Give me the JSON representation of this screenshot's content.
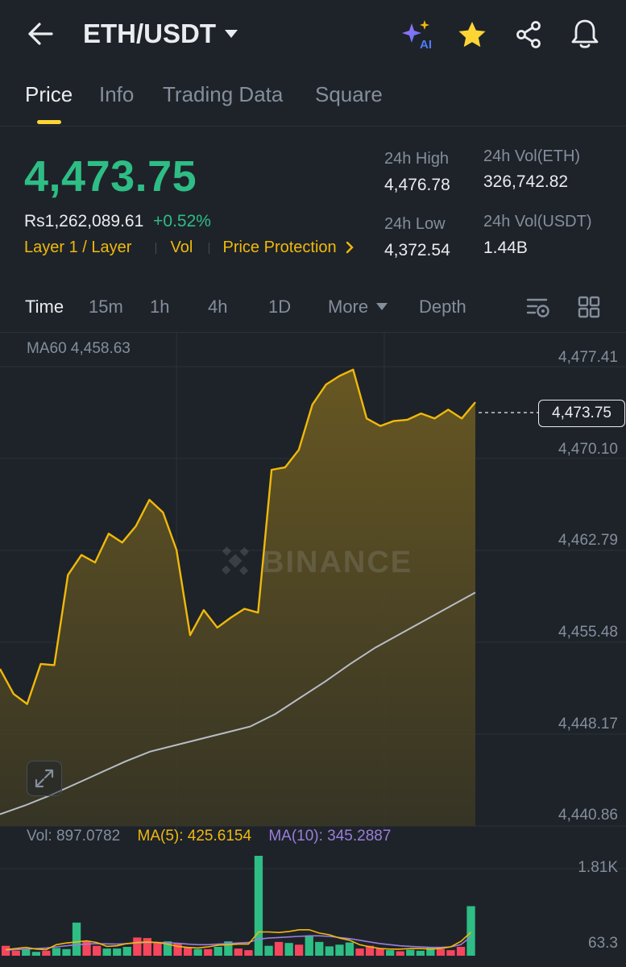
{
  "header": {
    "pair": "ETH/USDT",
    "icons": [
      "back-arrow-icon",
      "ai-sparkle-icon",
      "star-icon",
      "share-icon",
      "bell-icon"
    ],
    "ai_label": "AI"
  },
  "tabs": [
    {
      "label": "Price",
      "active": true
    },
    {
      "label": "Info"
    },
    {
      "label": "Trading Data"
    },
    {
      "label": "Square"
    }
  ],
  "ticker": {
    "last_price": "4,473.75",
    "fiat_price": "Rs1,262,089.61",
    "change_pct": "+0.52%",
    "tag_category": "Layer 1 / Layer",
    "tag_vol": "Vol",
    "price_protection": "Price Protection",
    "high_label": "24h High",
    "high_value": "4,476.78",
    "low_label": "24h Low",
    "low_value": "4,372.54",
    "vol_eth_label": "24h Vol(ETH)",
    "vol_eth_value": "326,742.82",
    "vol_usdt_label": "24h Vol(USDT)",
    "vol_usdt_value": "1.44B"
  },
  "timeframes": {
    "items": [
      "Time",
      "15m",
      "1h",
      "4h",
      "1D"
    ],
    "active": "Time",
    "more_label": "More",
    "depth_label": "Depth"
  },
  "chart": {
    "ma60_label": "MA60 4,458.63",
    "watermark": "BINANCE",
    "current_price": "4,473.75",
    "y_axis": [
      "4,477.41",
      "4,470.10",
      "4,462.79",
      "4,455.48",
      "4,448.17",
      "4,440.86"
    ],
    "vol_label": "Vol: 897.0782",
    "ma5_label": "MA(5): 425.6154",
    "ma10_label": "MA(10): 345.2887",
    "vol_axis": [
      "1.81K",
      "63.3"
    ]
  },
  "colors": {
    "up": "#2ebd85",
    "down": "#f6465d",
    "accent": "#fcd535",
    "price_line": "#f0b90b",
    "ma_line": "#b7bdc6",
    "ma10": "#9c7ddb"
  },
  "chart_data": {
    "type": "area",
    "title": "",
    "ylim": [
      4440.86,
      4477.41
    ],
    "price": [
      4452.5,
      4450.5,
      4449.7,
      4452.9,
      4452.8,
      4460.0,
      4461.6,
      4461.0,
      4463.3,
      4462.6,
      4463.9,
      4466.0,
      4465.0,
      4462.0,
      4455.2,
      4457.2,
      4455.8,
      4456.6,
      4457.3,
      4457.0,
      4468.4,
      4468.6,
      4470.0,
      4473.6,
      4475.2,
      4475.9,
      4476.4,
      4472.5,
      4471.9,
      4472.3,
      4472.4,
      4472.9,
      4472.5,
      4473.2,
      4472.5,
      4473.8
    ],
    "ma60": [
      4440.9,
      4441.6,
      4442.4,
      4443.3,
      4444.2,
      4445.1,
      4445.9,
      4446.4,
      4446.9,
      4447.4,
      4447.9,
      4448.9,
      4450.2,
      4451.5,
      4452.9,
      4454.2,
      4455.3,
      4456.4,
      4457.5,
      4458.6
    ],
    "volume": [
      180,
      90,
      110,
      70,
      90,
      140,
      120,
      600,
      270,
      180,
      130,
      130,
      160,
      330,
      320,
      230,
      260,
      220,
      150,
      120,
      120,
      160,
      260,
      130,
      100,
      1810,
      180,
      250,
      230,
      200,
      350,
      250,
      170,
      200,
      240,
      130,
      180,
      130,
      100,
      80,
      110,
      90,
      150,
      120,
      100,
      160,
      897
    ],
    "volume_up": [
      false,
      false,
      true,
      true,
      false,
      true,
      true,
      true,
      false,
      false,
      true,
      true,
      true,
      false,
      false,
      false,
      true,
      false,
      false,
      true,
      false,
      true,
      true,
      false,
      false,
      true,
      true,
      false,
      true,
      false,
      true,
      true,
      true,
      true,
      true,
      false,
      false,
      false,
      true,
      false,
      true,
      true,
      true,
      false,
      false,
      false,
      true
    ],
    "ma5": [
      110,
      130,
      150,
      120,
      110,
      200,
      230,
      250,
      270,
      240,
      170,
      180,
      220,
      240,
      250,
      240,
      210,
      170,
      150,
      140,
      160,
      190,
      200,
      210,
      210,
      430,
      430,
      420,
      440,
      470,
      470,
      410,
      380,
      320,
      280,
      200,
      160,
      130,
      120,
      120,
      130,
      130,
      120,
      130,
      160,
      260,
      425
    ],
    "ma10": [
      100,
      110,
      120,
      130,
      140,
      160,
      180,
      200,
      210,
      220,
      215,
      210,
      220,
      230,
      240,
      240,
      235,
      225,
      210,
      200,
      200,
      210,
      220,
      230,
      240,
      300,
      320,
      330,
      340,
      350,
      360,
      360,
      350,
      330,
      310,
      280,
      250,
      220,
      200,
      180,
      170,
      160,
      150,
      150,
      160,
      200,
      345
    ]
  }
}
